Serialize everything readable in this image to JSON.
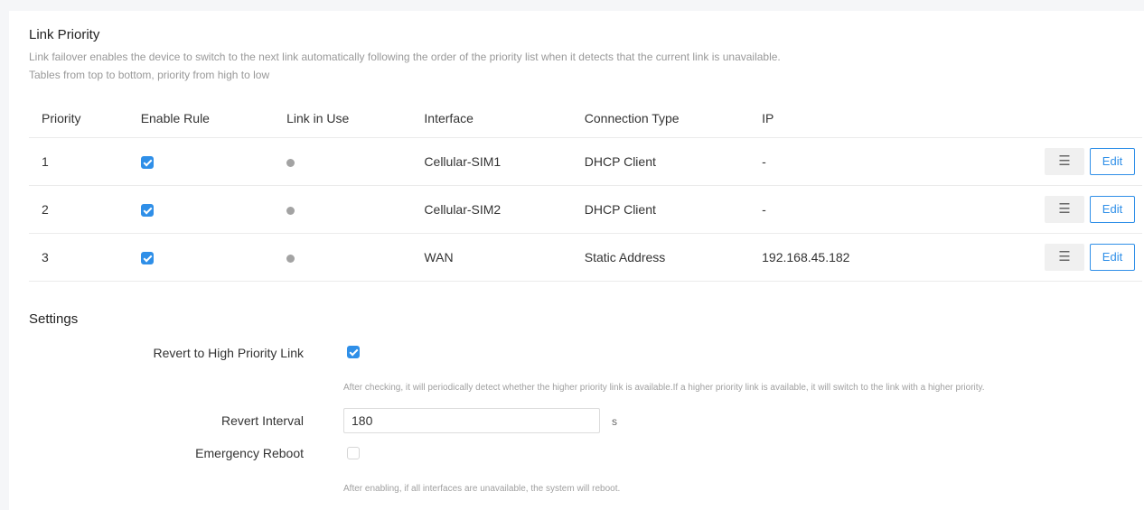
{
  "link_priority": {
    "title": "Link Priority",
    "description": "Link failover enables the device to switch to the next link automatically following the order of the priority list when it detects that the current link is unavailable.",
    "note": "Tables from top to bottom, priority from high to low",
    "columns": [
      "Priority",
      "Enable Rule",
      "Link in Use",
      "Interface",
      "Connection Type",
      "IP"
    ],
    "rows": [
      {
        "priority": "1",
        "enabled": true,
        "link_in_use": false,
        "interface": "Cellular-SIM1",
        "connection_type": "DHCP Client",
        "ip": "-"
      },
      {
        "priority": "2",
        "enabled": true,
        "link_in_use": false,
        "interface": "Cellular-SIM2",
        "connection_type": "DHCP Client",
        "ip": "-"
      },
      {
        "priority": "3",
        "enabled": true,
        "link_in_use": false,
        "interface": "WAN",
        "connection_type": "Static Address",
        "ip": "192.168.45.182"
      }
    ],
    "menu_icon": "hamburger-icon",
    "edit_label": "Edit"
  },
  "settings": {
    "title": "Settings",
    "revert_label": "Revert to High Priority Link",
    "revert_checked": true,
    "revert_hint": "After checking, it will periodically detect whether the higher priority link is available.If a higher priority link is available, it will switch to the link with a higher priority.",
    "interval_label": "Revert Interval",
    "interval_value": "180",
    "interval_unit": "s",
    "emergency_label": "Emergency Reboot",
    "emergency_checked": false,
    "emergency_hint": "After enabling, if all interfaces are unavailable, the system will reboot."
  },
  "colors": {
    "accent": "#2f8fe8",
    "status_dot": "#a3a3a3"
  }
}
